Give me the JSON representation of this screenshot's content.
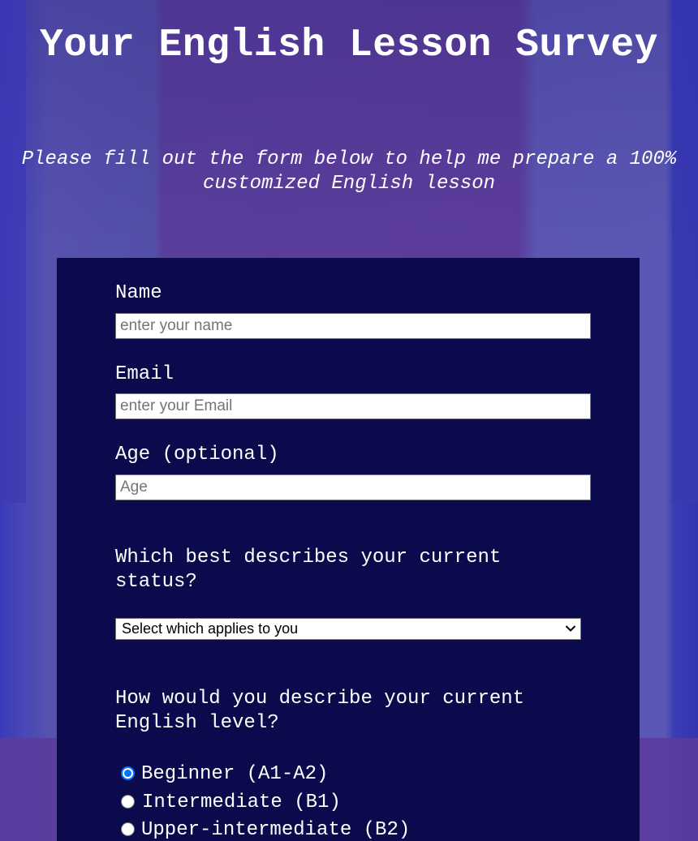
{
  "header": {
    "title": "Your English Lesson Survey",
    "subtitle": "Please fill out the form below to help me prepare a 100% customized English lesson"
  },
  "form": {
    "name": {
      "label": "Name",
      "placeholder": "enter your name",
      "value": ""
    },
    "email": {
      "label": "Email",
      "placeholder": "enter your Email",
      "value": ""
    },
    "age": {
      "label": "Age (optional)",
      "placeholder": "Age",
      "value": ""
    },
    "status": {
      "label": "Which best describes your current status?",
      "selected": "Select which applies to you"
    },
    "level": {
      "label": "How would you describe your current English level?",
      "options": [
        {
          "label": "Beginner (A1-A2)",
          "checked": true
        },
        {
          "label": "Intermediate (B1)",
          "checked": false
        },
        {
          "label": "Upper-intermediate (B2)",
          "checked": false
        }
      ]
    }
  },
  "colors": {
    "card_background": "#0a0a4c",
    "radio_accent": "#0075ff",
    "text": "#ffffff"
  },
  "icons": {
    "select_arrow": "chevron-down-icon"
  }
}
